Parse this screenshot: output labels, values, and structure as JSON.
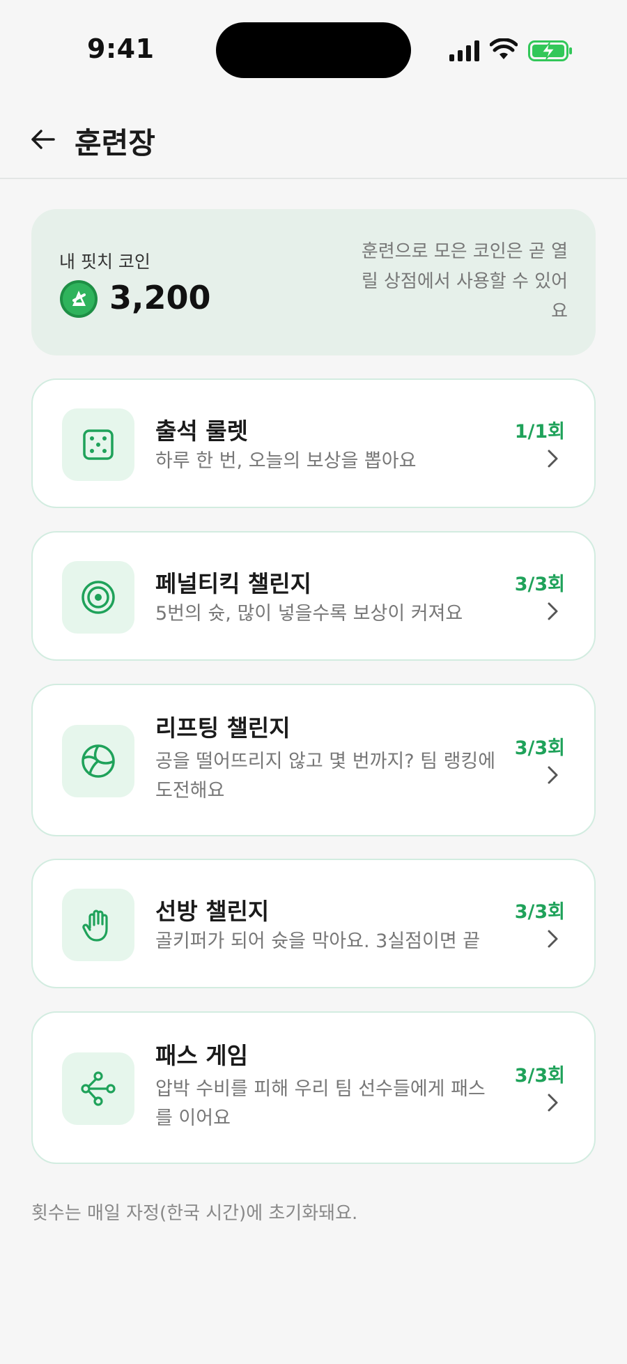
{
  "status_bar": {
    "time": "9:41"
  },
  "header": {
    "title": "훈련장"
  },
  "coin_card": {
    "label": "내 핏치 코인",
    "amount": "3,200",
    "note": "훈련으로 모은 코인은 곧 열릴 상점에서 사용할 수 있어요"
  },
  "challenges": [
    {
      "title": "출석 룰렛",
      "desc": "하루 한 번, 오늘의 보상을 뽑아요",
      "count": "1/1회",
      "icon": "dice-icon"
    },
    {
      "title": "페널티킥 챌린지",
      "desc": "5번의 슛, 많이 넣을수록 보상이 커져요",
      "count": "3/3회",
      "icon": "target-icon"
    },
    {
      "title": "리프팅 챌린지",
      "desc": "공을 떨어뜨리지 않고 몇 번까지? 팀 랭킹에 도전해요",
      "count": "3/3회",
      "icon": "ball-icon"
    },
    {
      "title": "선방 챌린지",
      "desc": "골키퍼가 되어 슛을 막아요. 3실점이면 끝",
      "count": "3/3회",
      "icon": "hand-icon"
    },
    {
      "title": "패스 게임",
      "desc": "압박 수비를 피해 우리 팀 선수들에게 패스를 이어요",
      "count": "3/3회",
      "icon": "share-nodes-icon"
    }
  ],
  "footer_note": "횟수는 매일 자정(한국 시간)에 초기화돼요.",
  "colors": {
    "accent": "#1fa25a",
    "coin_card_bg": "#e6f0ea",
    "icon_box_bg": "#e6f6ec",
    "card_border": "#d2ece0"
  }
}
